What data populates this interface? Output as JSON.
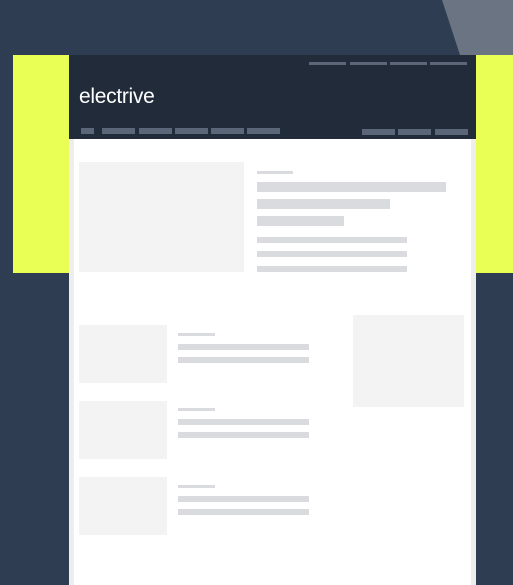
{
  "site": {
    "logo": "electrive"
  },
  "colors": {
    "page_background": "#2e3d51",
    "accent": "#eaff55",
    "header_background": "#212b3a",
    "header_placeholder": "#5b6678",
    "corner_shape": "#6a7483",
    "image_placeholder": "#f3f3f3",
    "text_placeholder": "#d9dbdf"
  },
  "header": {
    "top_links_count": 4,
    "nav_items_count": 6,
    "nav_actions_count": 3
  },
  "content": {
    "featured_count": 1,
    "article_list_count": 3,
    "sidebar_ad_count": 1
  }
}
